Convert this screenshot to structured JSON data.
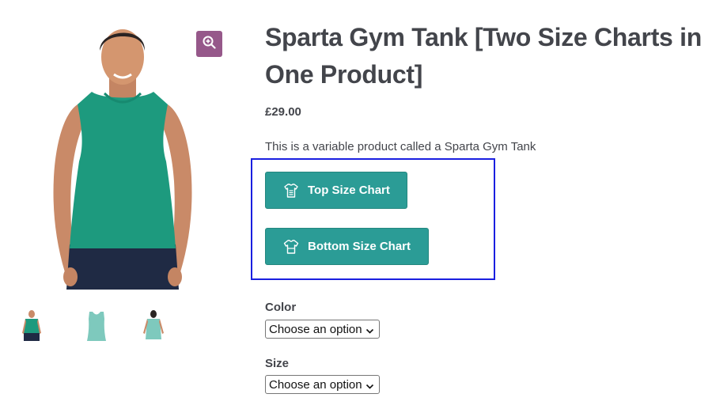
{
  "product": {
    "title": "Sparta Gym Tank [Two Size Charts in One Product]",
    "price": "£29.00",
    "description": "This is a variable product called a Sparta Gym Tank"
  },
  "gallery": {
    "main_image_icon": "product-photo",
    "zoom_icon": "magnifier-plus-icon",
    "thumbnails": [
      "thumb-front",
      "thumb-tank-only",
      "thumb-back"
    ]
  },
  "size_charts": {
    "top_label": "Top Size Chart",
    "bottom_label": "Bottom Size Chart",
    "top_icon": "tshirt-chart-icon",
    "bottom_icon": "tshirt-icon"
  },
  "attributes": {
    "color_label": "Color",
    "color_value": "Choose an option",
    "size_label": "Size",
    "size_value": "Choose an option"
  },
  "colors": {
    "button": "#2b9c96",
    "zoom": "#96588a",
    "highlight": "#1a1fe0",
    "text": "#43454b",
    "shirt": "#1d9a7e"
  }
}
